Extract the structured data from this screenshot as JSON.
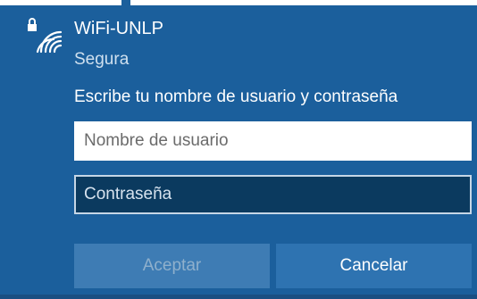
{
  "network": {
    "ssid": "WiFi-UNLP",
    "security": "Segura",
    "icon": "wifi-secured-icon"
  },
  "login": {
    "prompt": "Escribe tu nombre de usuario y contraseña",
    "username_placeholder": "Nombre de usuario",
    "username_value": "",
    "password_placeholder": "Contraseña",
    "password_value": ""
  },
  "buttons": {
    "accept_label": "Aceptar",
    "cancel_label": "Cancelar"
  },
  "colors": {
    "panel_background": "#1b5f9c",
    "accent_button": "#2e73b1",
    "disabled_button": "#3e7cb4",
    "password_field": "#0b3a5f"
  }
}
